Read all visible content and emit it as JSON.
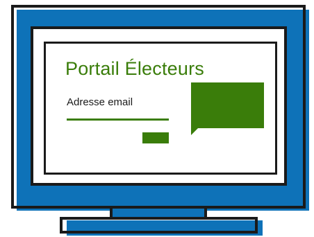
{
  "portal": {
    "title": "Portail Électeurs",
    "email_label": "Adresse email"
  },
  "colors": {
    "monitor": "#0e72b8",
    "accent": "#3a7d0a",
    "outline": "#1a1a1a"
  },
  "icons": {
    "chat": "speech-bubble-icon"
  }
}
